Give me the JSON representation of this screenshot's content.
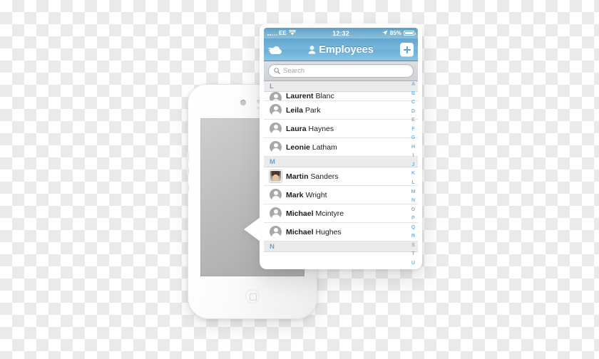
{
  "status_bar": {
    "carrier": "EE",
    "time": "12:32",
    "battery_percent": "85%",
    "signal_icon": "signal-dots-icon",
    "wifi_icon": "wifi-icon",
    "location_icon": "location-arrow-icon",
    "battery_icon": "battery-icon",
    "battery_level": 85
  },
  "nav_bar": {
    "left_icon": "cloud-icon",
    "title": "Employees",
    "title_icon": "person-icon",
    "add_label": "+",
    "add_icon": "plus-icon",
    "background_color": "#79b8dd"
  },
  "search": {
    "placeholder": "Search",
    "value": "",
    "icon": "search-icon"
  },
  "list": {
    "sections": [
      {
        "letter": "L",
        "contacts": [
          {
            "first": "Laurent",
            "last": "Blanc",
            "avatar": "default-avatar-icon",
            "clipped": true
          },
          {
            "first": "Leila",
            "last": "Park",
            "avatar": "default-avatar-icon",
            "clipped": false
          },
          {
            "first": "Laura",
            "last": "Haynes",
            "avatar": "default-avatar-icon",
            "clipped": false
          },
          {
            "first": "Leonie",
            "last": "Latham",
            "avatar": "default-avatar-icon",
            "clipped": false
          }
        ]
      },
      {
        "letter": "M",
        "contacts": [
          {
            "first": "Martin",
            "last": "Sanders",
            "avatar": "photo-avatar",
            "clipped": false
          },
          {
            "first": "Mark",
            "last": "Wright",
            "avatar": "default-avatar-icon",
            "clipped": false
          },
          {
            "first": "Michael",
            "last": "Mcintyre",
            "avatar": "default-avatar-icon",
            "clipped": false
          },
          {
            "first": "Michael",
            "last": "Hughes",
            "avatar": "default-avatar-icon",
            "clipped": false
          }
        ]
      },
      {
        "letter": "N",
        "contacts": []
      }
    ]
  },
  "alpha_index": {
    "letters": [
      "A",
      "B",
      "C",
      "D",
      "E",
      "F",
      "G",
      "H",
      "I",
      "J",
      "K",
      "L",
      "M",
      "N",
      "O",
      "P",
      "Q",
      "R",
      "S",
      "T",
      "U"
    ],
    "color": "#79b3e0"
  },
  "phone": {
    "device": "iphone-mockup",
    "camera_icon": "front-camera-icon",
    "speaker_icon": "earpiece-speaker-icon",
    "home_button_icon": "home-button-icon"
  },
  "colors": {
    "accent_blue": "#79b8dd",
    "index_blue": "#79b3e0",
    "section_header_bg": "#ebebeb",
    "checker_light": "#ebebeb",
    "checker_white": "#ffffff"
  }
}
